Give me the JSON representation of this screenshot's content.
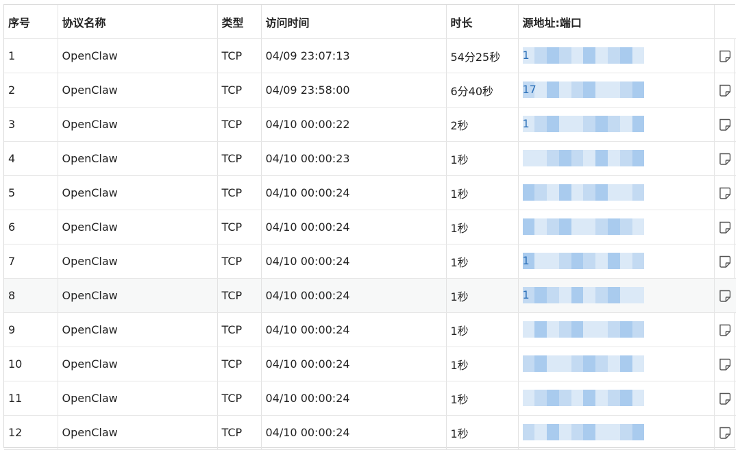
{
  "columns": {
    "no": "序号",
    "protocol": "协议名称",
    "type": "类型",
    "time": "访问时间",
    "duration": "时长",
    "source": "源地址:端口"
  },
  "rows": [
    {
      "no": "1",
      "protocol": "OpenClaw",
      "type": "TCP",
      "time": "04/09 23:07:13",
      "duration": "54分25秒",
      "source_visible": "1"
    },
    {
      "no": "2",
      "protocol": "OpenClaw",
      "type": "TCP",
      "time": "04/09 23:58:00",
      "duration": "6分40秒",
      "source_visible": "17"
    },
    {
      "no": "3",
      "protocol": "OpenClaw",
      "type": "TCP",
      "time": "04/10 00:00:22",
      "duration": "2秒",
      "source_visible": "1"
    },
    {
      "no": "4",
      "protocol": "OpenClaw",
      "type": "TCP",
      "time": "04/10 00:00:23",
      "duration": "1秒",
      "source_visible": ""
    },
    {
      "no": "5",
      "protocol": "OpenClaw",
      "type": "TCP",
      "time": "04/10 00:00:24",
      "duration": "1秒",
      "source_visible": ""
    },
    {
      "no": "6",
      "protocol": "OpenClaw",
      "type": "TCP",
      "time": "04/10 00:00:24",
      "duration": "1秒",
      "source_visible": ""
    },
    {
      "no": "7",
      "protocol": "OpenClaw",
      "type": "TCP",
      "time": "04/10 00:00:24",
      "duration": "1秒",
      "source_visible": "1"
    },
    {
      "no": "8",
      "protocol": "OpenClaw",
      "type": "TCP",
      "time": "04/10 00:00:24",
      "duration": "1秒",
      "source_visible": "1"
    },
    {
      "no": "9",
      "protocol": "OpenClaw",
      "type": "TCP",
      "time": "04/10 00:00:24",
      "duration": "1秒",
      "source_visible": ""
    },
    {
      "no": "10",
      "protocol": "OpenClaw",
      "type": "TCP",
      "time": "04/10 00:00:24",
      "duration": "1秒",
      "source_visible": ""
    },
    {
      "no": "11",
      "protocol": "OpenClaw",
      "type": "TCP",
      "time": "04/10 00:00:24",
      "duration": "1秒",
      "source_visible": ""
    },
    {
      "no": "12",
      "protocol": "OpenClaw",
      "type": "TCP",
      "time": "04/10 00:00:24",
      "duration": "1秒",
      "source_visible": ""
    }
  ],
  "row_action_icon": "note-icon",
  "colors": {
    "link": "#2a6fb8",
    "mosaic_light": "#dbe9f7",
    "mosaic_mid": "#c3daf2",
    "mosaic_dark": "#a9cbee",
    "alt_row_bg": "#f7f8f8",
    "border": "#e3e3e3"
  }
}
